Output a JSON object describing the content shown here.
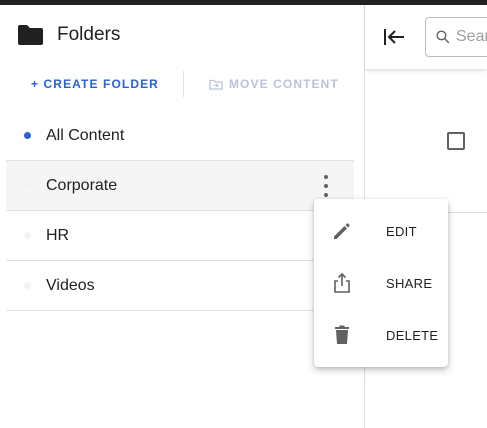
{
  "sidebar": {
    "title": "Folders",
    "folder_icon": "folder-icon",
    "actions": {
      "create_label": "+ CREATE FOLDER",
      "move_label": "MOVE CONTENT"
    },
    "folders": [
      {
        "label": "All Content",
        "active": true
      },
      {
        "label": "Corporate",
        "hovered": true
      },
      {
        "label": "HR"
      },
      {
        "label": "Videos"
      }
    ]
  },
  "main": {
    "search": {
      "value": "",
      "placeholder": "Search"
    }
  },
  "context_menu": {
    "items": [
      {
        "label": "EDIT",
        "icon": "pencil-icon"
      },
      {
        "label": "SHARE",
        "icon": "share-icon"
      },
      {
        "label": "DELETE",
        "icon": "trash-icon"
      }
    ]
  },
  "colors": {
    "accent": "#2962d6",
    "disabled": "#b9c3dc",
    "top_bar": "#222222",
    "hover_row": "#f5f5f5"
  }
}
